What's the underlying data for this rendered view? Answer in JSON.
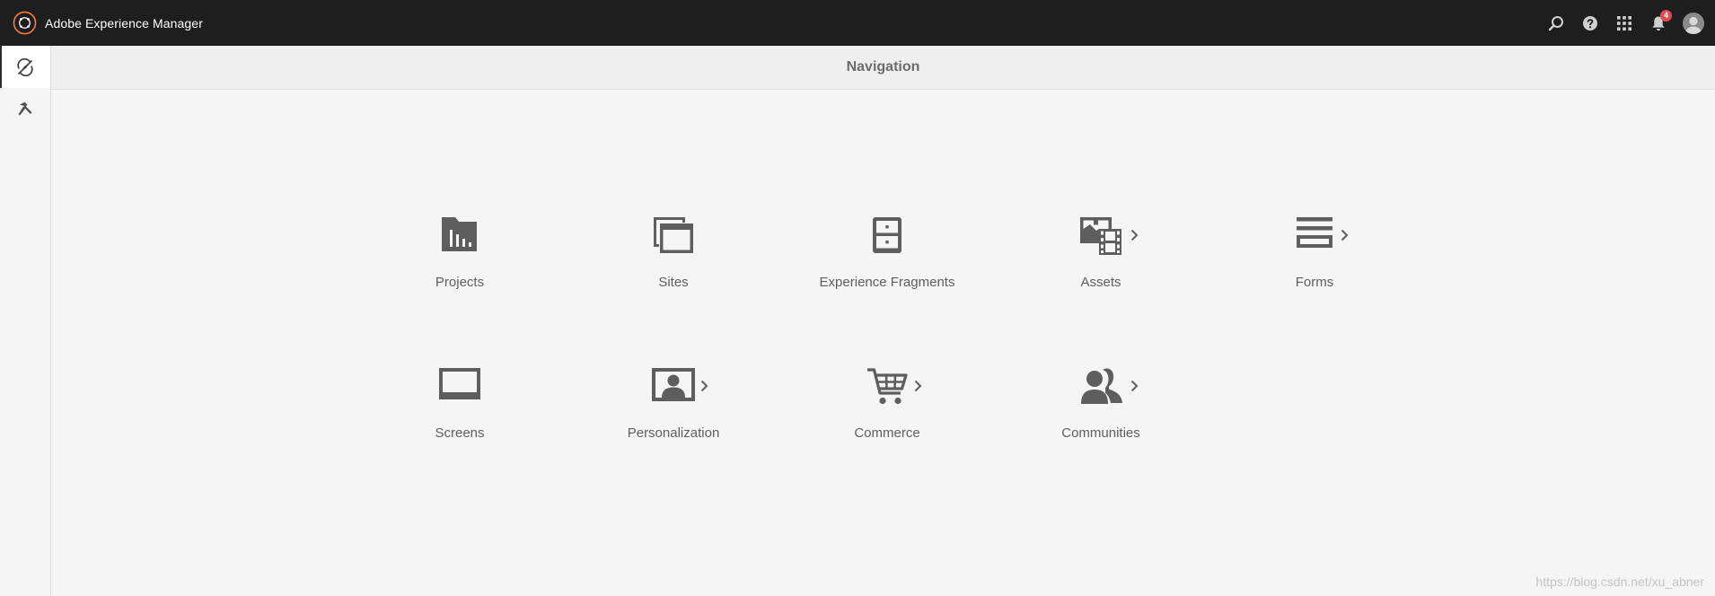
{
  "shell": {
    "app_title": "Adobe Experience Manager",
    "notification_count": "4",
    "icons": [
      "adobe-experience-manager-logo",
      "search-icon",
      "help-icon",
      "solutions-grid-icon",
      "bell-icon",
      "user-avatar"
    ]
  },
  "rail": {
    "items": [
      {
        "icon": "navigation-compass-icon",
        "active": true
      },
      {
        "icon": "tools-hammer-icon",
        "active": false
      }
    ]
  },
  "header": {
    "title": "Navigation"
  },
  "nav": {
    "tiles": [
      {
        "label": "Projects",
        "icon": "projects-folder-icon",
        "has_submenu": false
      },
      {
        "label": "Sites",
        "icon": "sites-windows-icon",
        "has_submenu": false
      },
      {
        "label": "Experience Fragments",
        "icon": "experience-fragments-cabinet-icon",
        "has_submenu": false
      },
      {
        "label": "Assets",
        "icon": "assets-media-icon",
        "has_submenu": true
      },
      {
        "label": "Forms",
        "icon": "forms-icon",
        "has_submenu": true
      },
      {
        "label": "Screens",
        "icon": "screens-monitor-icon",
        "has_submenu": false
      },
      {
        "label": "Personalization",
        "icon": "personalization-icon",
        "has_submenu": true
      },
      {
        "label": "Commerce",
        "icon": "commerce-cart-icon",
        "has_submenu": true
      },
      {
        "label": "Communities",
        "icon": "communities-users-icon",
        "has_submenu": true
      }
    ]
  },
  "watermark": "https://blog.csdn.net/xu_abner",
  "colors": {
    "shell_bg": "#1e1e1e",
    "logo_accent": "#ff7f37",
    "page_bg": "#f5f5f5",
    "icon_gray": "#5e5e5e",
    "badge_red": "#e34850"
  }
}
